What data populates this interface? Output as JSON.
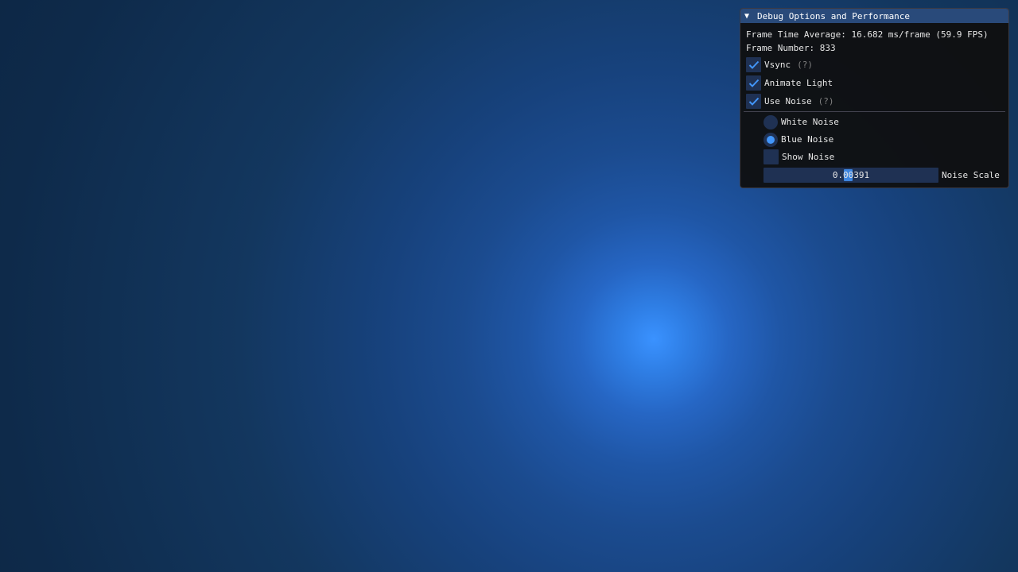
{
  "window": {
    "title": "Debug Options and Performance",
    "collapse_icon": "triangle-down-icon"
  },
  "stats": {
    "frame_time": "Frame Time Average: 16.682 ms/frame (59.9 FPS)",
    "frame_number": "Frame Number: 833"
  },
  "options": {
    "vsync_label": "Vsync",
    "vsync_checked": true,
    "vsync_help": "(?)",
    "animate_light_label": "Animate Light",
    "animate_light_checked": true,
    "use_noise_label": "Use Noise",
    "use_noise_checked": true,
    "use_noise_help": "(?)"
  },
  "noise": {
    "white_label": "White Noise",
    "blue_label": "Blue Noise",
    "selected": "Blue Noise",
    "show_noise_label": "Show Noise",
    "show_noise_checked": false,
    "scale_value": "0.00391",
    "scale_label": "Noise Scale"
  },
  "colors": {
    "accent": "#4296fa",
    "title_bar": "#294a7a",
    "frame_bg": "#1f3153",
    "panel_bg": "#0f0f0f",
    "scene_light": "#3a92ff",
    "scene_dark": "#0b2440"
  }
}
